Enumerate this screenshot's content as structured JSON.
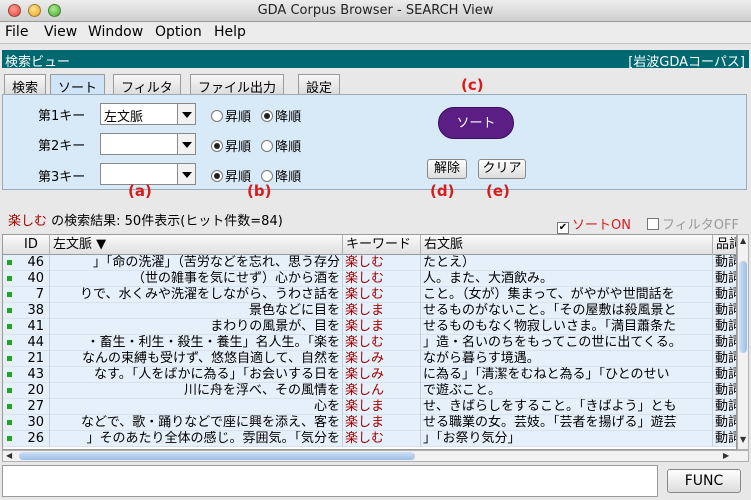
{
  "window": {
    "title": "GDA Corpus Browser - SEARCH View"
  },
  "menu": {
    "file": "File",
    "view": "View",
    "window": "Window",
    "option": "Option",
    "help": "Help"
  },
  "viewbar": {
    "left": "検索ビュー",
    "right": "[岩波GDAコーパス]"
  },
  "tabs": [
    "検索",
    "ソート",
    "フィルタ",
    "ファイル出力",
    "設定"
  ],
  "sort_panel": {
    "key1_label": "第1キー",
    "key1_value": "左文脈",
    "key2_label": "第2キー",
    "key2_value": "",
    "key3_label": "第3キー",
    "key3_value": "",
    "asc": "昇順",
    "desc": "降順",
    "sort_button": "ソート",
    "release_button": "解除",
    "clear_button": "クリア"
  },
  "annotations": {
    "a": "(a)",
    "b": "(b)",
    "c": "(c)",
    "d": "(d)",
    "e": "(e)"
  },
  "result": {
    "keyword": "楽しむ",
    "summary": " の検索結果: 50件表示(ヒット件数=84)",
    "sort_on": "ソートON",
    "filter_off": "フィルタOFF"
  },
  "table": {
    "headers": {
      "id": "ID",
      "left": "左文脈 ▼",
      "keyword": "キーワード",
      "right": "右文脈",
      "pos": "品詞"
    },
    "rows": [
      {
        "id": "46",
        "left": "」「命の洗濯」（苦労などを忘れ、思う存分",
        "kw": "楽しむ",
        "right": "たとえ）",
        "pos": "動詞"
      },
      {
        "id": "40",
        "left": "（世の雑事を気にせず）心から酒を",
        "kw": "楽しむ",
        "right": "人。また、大酒飲み。",
        "pos": "動詞"
      },
      {
        "id": "7",
        "left": "りで、水くみや洗濯をしながら、うわさ話を",
        "kw": "楽しむ",
        "right": "こと。（女が）集まって、がやがや世間話を",
        "pos": "動詞"
      },
      {
        "id": "38",
        "left": "景色などに目を",
        "kw": "楽しま",
        "right": "せるものがないこと。「その屋敷は殺風景と",
        "pos": "動詞"
      },
      {
        "id": "41",
        "left": "まわりの風景が、目を",
        "kw": "楽しま",
        "right": "せるものもなく物寂しいさま。「満目蕭条た",
        "pos": "動詞"
      },
      {
        "id": "44",
        "left": "・畜生・利生・殺生・養生」名人生。「楽を",
        "kw": "楽しむ",
        "right": "」造・名いのちをもってこの世に出てくる。",
        "pos": "動詞"
      },
      {
        "id": "21",
        "left": "なんの束縛も受けず、悠悠自適して、自然を",
        "kw": "楽しみ",
        "right": "ながら暮らす境遇。",
        "pos": "動詞"
      },
      {
        "id": "43",
        "left": "なす。「人をばかに為る」「お会いする日を",
        "kw": "楽しみ",
        "right": "に為る」「清潔をむねと為る」「ひとのせい",
        "pos": "動詞"
      },
      {
        "id": "20",
        "left": "川に舟を浮べ、その風情を",
        "kw": "楽しん",
        "right": "で遊ぶこと。",
        "pos": "動詞"
      },
      {
        "id": "27",
        "left": "心を",
        "kw": "楽しま",
        "right": "せ、きばらしをすること。「きばよう」とも",
        "pos": "動詞"
      },
      {
        "id": "30",
        "left": "などで、歌・踊りなどで座に興を添え、客を",
        "kw": "楽しま",
        "right": "せる職業の女。芸妓。「芸者を揚げる」遊芸",
        "pos": "動詞"
      },
      {
        "id": "26",
        "left": "」そのあたり全体の感じ。雰囲気。「気分を",
        "kw": "楽しむ",
        "right": "」「お祭り気分」",
        "pos": "動詞"
      }
    ]
  },
  "bottom": {
    "func_button": "FUNC"
  }
}
